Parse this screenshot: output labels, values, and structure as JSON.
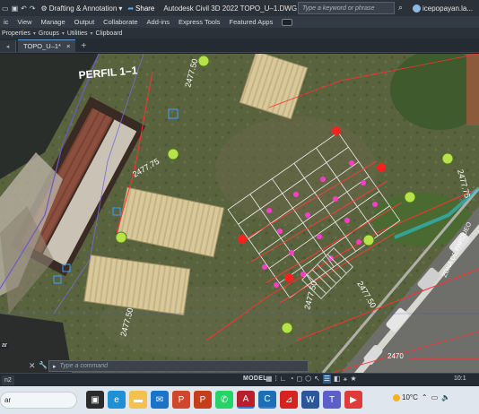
{
  "titlebar": {
    "workspace": "Drafting & Annotation",
    "share_label": "Share",
    "app_title": "Autodesk Civil 3D 2022  TOPO_U–1.DWG",
    "search_placeholder": "Type a keyword or phrase",
    "user_name": "icepopayan.la..."
  },
  "ribbon": {
    "tabs": [
      "ic",
      "View",
      "Manage",
      "Output",
      "Collaborate",
      "Add-ins",
      "Express Tools",
      "Featured Apps"
    ]
  },
  "panels": [
    "Properties",
    "Groups",
    "Utilities",
    "Clipboard"
  ],
  "document_tabs": {
    "active": "TOPO_U–1*"
  },
  "drawing": {
    "labels": {
      "perfil": "PERFIL 1–1",
      "z1": "2477.75",
      "z2": "2477.50",
      "z3": "2477.50",
      "z4": "2477.50",
      "z5": "2477.75",
      "z6": "2477.50",
      "z7": "2470",
      "zona": "ZONA DE PARQUEO"
    }
  },
  "command_line": {
    "placeholder": "Type a command"
  },
  "side_label": "ar",
  "statusbar": {
    "layout_tab": "n2",
    "model_label": "MODEL",
    "scale": "10:1"
  },
  "taskbar": {
    "search_text": "ar",
    "weather": "10°C",
    "icons": [
      "taskview-icon",
      "edge-icon",
      "explorer-icon",
      "mail-icon",
      "powerpoint-icon",
      "powerpoint-icon",
      "whatsapp-icon",
      "autocad-icon",
      "civil3d-icon",
      "pdf-icon",
      "word-icon",
      "teams-icon",
      "video-icon"
    ]
  }
}
